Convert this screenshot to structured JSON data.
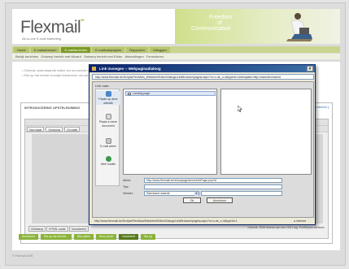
{
  "header": {
    "logo_text": "Flexmail",
    "logo_mark": "x",
    "logo_sup": "BE",
    "tagline": "All-in-one E-mail Marketing",
    "hero_line1": "Freedom",
    "hero_line2": "of",
    "hero_line3": "Communication"
  },
  "nav": {
    "items": [
      {
        "label": "Home"
      },
      {
        "label": "E-mailadressen"
      },
      {
        "label": "E-mailberichten",
        "active": true
      },
      {
        "label": "E-mailcampagnes"
      },
      {
        "label": "Rapporten"
      },
      {
        "label": "Uitloggen"
      }
    ]
  },
  "subnav": {
    "items": [
      {
        "label": "Bekijk berichten"
      },
      {
        "label": "Ontwerp bericht met Wizard"
      },
      {
        "label": "Ontwerp bericht met Editor"
      },
      {
        "label": "Afbeeldingen"
      },
      {
        "label": "Formulieren"
      }
    ]
  },
  "page": {
    "note1": "• Gebruik onderstaande editor om uw bericht op te stellen.",
    "note2": "• Klik op het eerste icoontje linksboven om uw bericht als bijlage toe te voegen.",
    "panel_title": "INTRODUCERING OPSTELRUIMING",
    "panel_link": "Voorbeeld ]",
    "font_select": "Normaal",
    "font_select2": "Verdana",
    "font_select3": "Grootte",
    "doc_letter": "F",
    "tabs": [
      "Ontwerp",
      "HTML code",
      "Voorbeeld"
    ],
    "status_right": "Gebruik: 2535 tekens van een 10K1 tag. ProfiMyran verslaan",
    "greenbar": [
      {
        "label": "Annuleren"
      },
      {
        "label": "Sla op als bericht..."
      },
      {
        "label": "Wis opties"
      },
      {
        "label": "Stuur proef"
      },
      {
        "label": "Voorbeeld",
        "dark": true
      },
      {
        "label": "Sla op"
      }
    ],
    "footer": "© Flexmail 2005"
  },
  "dialog": {
    "title": "Link invoegen -- Webpaginadialoog",
    "close": "×",
    "url": "http://www.flexmail.be/Scripts/FlexMain_Wlexhtml/Editor/Dialogs/LinkBrowser/pagina.aspx?nr=x-de_n-4&typeId=1&template=http://www.flexmail.be",
    "link_to": "Link naar:",
    "sources": [
      {
        "label": "Plaats op deze website",
        "icon": "globe-icon",
        "color": "#4a86c8",
        "selected": true
      },
      {
        "label": "Plaats in deze document",
        "icon": "document-icon",
        "color": "#d9d9d9"
      },
      {
        "label": "E-mail adres",
        "icon": "mail-icon",
        "color": "#c9c9c9"
      },
      {
        "label": "Web locatie",
        "icon": "web-icon",
        "color": "#3a9a4a"
      }
    ],
    "tree_item": "Landing page",
    "adres_label": "Adres:",
    "adres_value": "http://www.flexmail.be/showpage/show/infoPage.php?id",
    "tips_label": "Tips:",
    "tips_value": "",
    "venster_label": "Venster:",
    "venster_value": "Standaard waarde",
    "ok_label": "Ok",
    "cancel_label": "Annuleren",
    "status_url": "http://www.flexmail.be/Scripts/FlexMain/Wlexhtml/Editor/Dialogs/LinkBrowser/pagina.aspx?nr=x-de_n-4&typeId=1",
    "status_zone": "Internet"
  }
}
